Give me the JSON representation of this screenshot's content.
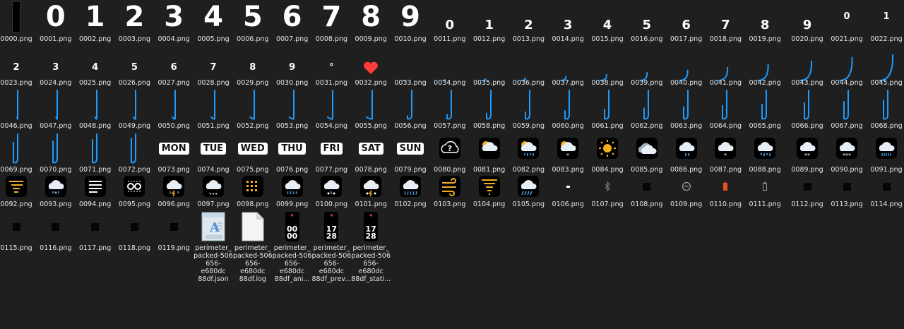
{
  "files": [
    {
      "name": "0000.png",
      "kind": "tall-bar"
    },
    {
      "name": "0001.png",
      "kind": "big-digit",
      "text": "0"
    },
    {
      "name": "0002.png",
      "kind": "big-digit",
      "text": "1"
    },
    {
      "name": "0003.png",
      "kind": "big-digit",
      "text": "2"
    },
    {
      "name": "0004.png",
      "kind": "big-digit",
      "text": "3"
    },
    {
      "name": "0005.png",
      "kind": "big-digit",
      "text": "4"
    },
    {
      "name": "0006.png",
      "kind": "big-digit",
      "text": "5"
    },
    {
      "name": "0007.png",
      "kind": "big-digit",
      "text": "6"
    },
    {
      "name": "0008.png",
      "kind": "big-digit",
      "text": "7"
    },
    {
      "name": "0009.png",
      "kind": "big-digit",
      "text": "8"
    },
    {
      "name": "0010.png",
      "kind": "big-digit",
      "text": "9"
    },
    {
      "name": "0011.png",
      "kind": "mid-digit",
      "text": "0"
    },
    {
      "name": "0012.png",
      "kind": "mid-digit",
      "text": "1"
    },
    {
      "name": "0013.png",
      "kind": "mid-digit",
      "text": "2"
    },
    {
      "name": "0014.png",
      "kind": "mid-digit",
      "text": "3"
    },
    {
      "name": "0015.png",
      "kind": "mid-digit",
      "text": "4"
    },
    {
      "name": "0016.png",
      "kind": "mid-digit",
      "text": "5"
    },
    {
      "name": "0017.png",
      "kind": "mid-digit",
      "text": "6"
    },
    {
      "name": "0018.png",
      "kind": "mid-digit",
      "text": "7"
    },
    {
      "name": "0019.png",
      "kind": "mid-digit",
      "text": "8"
    },
    {
      "name": "0020.png",
      "kind": "mid-digit",
      "text": "9"
    },
    {
      "name": "0021.png",
      "kind": "small-digit",
      "text": "0"
    },
    {
      "name": "0022.png",
      "kind": "small-digit",
      "text": "1"
    },
    {
      "name": "0023.png",
      "kind": "small-digit",
      "text": "2"
    },
    {
      "name": "0024.png",
      "kind": "small-digit",
      "text": "3"
    },
    {
      "name": "0025.png",
      "kind": "small-digit",
      "text": "4"
    },
    {
      "name": "0026.png",
      "kind": "small-digit",
      "text": "5"
    },
    {
      "name": "0027.png",
      "kind": "small-digit",
      "text": "6"
    },
    {
      "name": "0028.png",
      "kind": "small-digit",
      "text": "7"
    },
    {
      "name": "0029.png",
      "kind": "small-digit",
      "text": "8"
    },
    {
      "name": "0030.png",
      "kind": "small-digit",
      "text": "9"
    },
    {
      "name": "0031.png",
      "kind": "degree",
      "text": "°"
    },
    {
      "name": "0032.png",
      "kind": "heart"
    },
    {
      "name": "0033.png",
      "kind": "arc",
      "level": 1
    },
    {
      "name": "0034.png",
      "kind": "arc",
      "level": 2
    },
    {
      "name": "0035.png",
      "kind": "arc",
      "level": 3
    },
    {
      "name": "0036.png",
      "kind": "arc",
      "level": 4
    },
    {
      "name": "0037.png",
      "kind": "arc",
      "level": 5
    },
    {
      "name": "0038.png",
      "kind": "arc",
      "level": 6
    },
    {
      "name": "0039.png",
      "kind": "arc",
      "level": 7
    },
    {
      "name": "0040.png",
      "kind": "arc",
      "level": 8
    },
    {
      "name": "0041.png",
      "kind": "arc",
      "level": 9
    },
    {
      "name": "0042.png",
      "kind": "arc",
      "level": 10
    },
    {
      "name": "0043.png",
      "kind": "arc",
      "level": 11
    },
    {
      "name": "0044.png",
      "kind": "arc",
      "level": 12
    },
    {
      "name": "0045.png",
      "kind": "arc",
      "level": 13
    },
    {
      "name": "0046.png",
      "kind": "arc",
      "level": 14
    },
    {
      "name": "0047.png",
      "kind": "arc",
      "level": 15
    },
    {
      "name": "0048.png",
      "kind": "arc",
      "level": 16
    },
    {
      "name": "0049.png",
      "kind": "arc",
      "level": 17
    },
    {
      "name": "0050.png",
      "kind": "arc",
      "level": 18
    },
    {
      "name": "0051.png",
      "kind": "arc",
      "level": 19
    },
    {
      "name": "0052.png",
      "kind": "arc",
      "level": 20
    },
    {
      "name": "0053.png",
      "kind": "arc",
      "level": 21
    },
    {
      "name": "0054.png",
      "kind": "arc",
      "level": 22
    },
    {
      "name": "0055.png",
      "kind": "arc",
      "level": 23
    },
    {
      "name": "0056.png",
      "kind": "arc",
      "level": 24
    },
    {
      "name": "0057.png",
      "kind": "arc",
      "level": 25
    },
    {
      "name": "0058.png",
      "kind": "arc",
      "level": 26
    },
    {
      "name": "0059.png",
      "kind": "arc",
      "level": 27
    },
    {
      "name": "0060.png",
      "kind": "arc",
      "level": 28
    },
    {
      "name": "0061.png",
      "kind": "arc",
      "level": 29
    },
    {
      "name": "0062.png",
      "kind": "arc",
      "level": 30
    },
    {
      "name": "0063.png",
      "kind": "arc",
      "level": 31
    },
    {
      "name": "0064.png",
      "kind": "arc",
      "level": 32
    },
    {
      "name": "0065.png",
      "kind": "arc",
      "level": 33
    },
    {
      "name": "0066.png",
      "kind": "arc",
      "level": 34
    },
    {
      "name": "0067.png",
      "kind": "arc",
      "level": 35
    },
    {
      "name": "0068.png",
      "kind": "arc",
      "level": 36
    },
    {
      "name": "0069.png",
      "kind": "arc",
      "level": 37
    },
    {
      "name": "0070.png",
      "kind": "arc",
      "level": 38
    },
    {
      "name": "0071.png",
      "kind": "arc",
      "level": 39
    },
    {
      "name": "0072.png",
      "kind": "arc",
      "level": 40
    },
    {
      "name": "0073.png",
      "kind": "day",
      "text": "MON"
    },
    {
      "name": "0074.png",
      "kind": "day",
      "text": "TUE"
    },
    {
      "name": "0075.png",
      "kind": "day",
      "text": "WED"
    },
    {
      "name": "0076.png",
      "kind": "day",
      "text": "THU"
    },
    {
      "name": "0077.png",
      "kind": "day",
      "text": "FRI"
    },
    {
      "name": "0078.png",
      "kind": "day",
      "text": "SAT"
    },
    {
      "name": "0079.png",
      "kind": "day",
      "text": "SUN"
    },
    {
      "name": "0080.png",
      "kind": "weather",
      "icon": "unknown-weather-icon"
    },
    {
      "name": "0081.png",
      "kind": "weather",
      "icon": "partly-cloudy-icon"
    },
    {
      "name": "0082.png",
      "kind": "weather",
      "icon": "partly-cloudy-rain-icon"
    },
    {
      "name": "0083.png",
      "kind": "weather",
      "icon": "partly-cloudy-snow-icon"
    },
    {
      "name": "0084.png",
      "kind": "weather",
      "icon": "sunny-icon"
    },
    {
      "name": "0085.png",
      "kind": "weather",
      "icon": "cloudy-icon"
    },
    {
      "name": "0086.png",
      "kind": "weather",
      "icon": "light-rain-icon"
    },
    {
      "name": "0087.png",
      "kind": "weather",
      "icon": "light-snow-icon"
    },
    {
      "name": "0088.png",
      "kind": "weather",
      "icon": "moderate-rain-icon"
    },
    {
      "name": "0089.png",
      "kind": "weather",
      "icon": "moderate-snow-icon"
    },
    {
      "name": "0090.png",
      "kind": "weather",
      "icon": "heavy-snow-icon"
    },
    {
      "name": "0091.png",
      "kind": "weather",
      "icon": "heavy-rain-icon"
    },
    {
      "name": "0092.png",
      "kind": "weather",
      "icon": "sandstorm-icon"
    },
    {
      "name": "0093.png",
      "kind": "weather",
      "icon": "sleet-icon"
    },
    {
      "name": "0094.png",
      "kind": "weather",
      "icon": "fog-icon"
    },
    {
      "name": "0095.png",
      "kind": "weather",
      "icon": "haze-icon"
    },
    {
      "name": "0096.png",
      "kind": "weather",
      "icon": "thunder-rain-icon"
    },
    {
      "name": "0097.png",
      "kind": "weather",
      "icon": "snow-shower-icon"
    },
    {
      "name": "0098.png",
      "kind": "weather",
      "icon": "dust-icon"
    },
    {
      "name": "0099.png",
      "kind": "weather",
      "icon": "rain-shower-icon"
    },
    {
      "name": "0100.png",
      "kind": "weather",
      "icon": "hail-icon"
    },
    {
      "name": "0101.png",
      "kind": "weather",
      "icon": "thunder-hail-icon"
    },
    {
      "name": "0102.png",
      "kind": "weather",
      "icon": "downpour-icon"
    },
    {
      "name": "0103.png",
      "kind": "weather",
      "icon": "wind-icon"
    },
    {
      "name": "0104.png",
      "kind": "weather",
      "icon": "tornado-icon"
    },
    {
      "name": "0105.png",
      "kind": "weather",
      "icon": "storm-rain-icon"
    },
    {
      "name": "0106.png",
      "kind": "dash"
    },
    {
      "name": "0107.png",
      "kind": "bluetooth"
    },
    {
      "name": "0108.png",
      "kind": "square"
    },
    {
      "name": "0109.png",
      "kind": "dnd"
    },
    {
      "name": "0110.png",
      "kind": "battery-low"
    },
    {
      "name": "0111.png",
      "kind": "battery"
    },
    {
      "name": "0112.png",
      "kind": "square"
    },
    {
      "name": "0113.png",
      "kind": "square"
    },
    {
      "name": "0114.png",
      "kind": "square"
    },
    {
      "name": "0115.png",
      "kind": "square"
    },
    {
      "name": "0116.png",
      "kind": "square"
    },
    {
      "name": "0117.png",
      "kind": "square"
    },
    {
      "name": "0118.png",
      "kind": "square"
    },
    {
      "name": "0119.png",
      "kind": "square"
    },
    {
      "name": "perimeter_\npacked-506\n656-e680dc\n88df.json",
      "kind": "json-file"
    },
    {
      "name": "perimeter_\npacked-506\n656-e680dc\n88df.log",
      "kind": "log-file"
    },
    {
      "name": "perimeter_\npacked-506\n656-e680dc\n88df_ani...",
      "kind": "preview-anim",
      "text": "00\n00"
    },
    {
      "name": "perimeter_\npacked-506\n656-e680dc\n88df_prev...",
      "kind": "preview",
      "text": "17\n28"
    },
    {
      "name": "perimeter_\npacked-506\n656-e680dc\n88df_stati...",
      "kind": "preview",
      "text": "17\n28"
    }
  ],
  "colors": {
    "background": "#1f1f1f",
    "arc": "#1e9bff",
    "heart": "#ff3b3b",
    "weather_blue": "#4aa3e8",
    "weather_yellow": "#f2b01e"
  }
}
